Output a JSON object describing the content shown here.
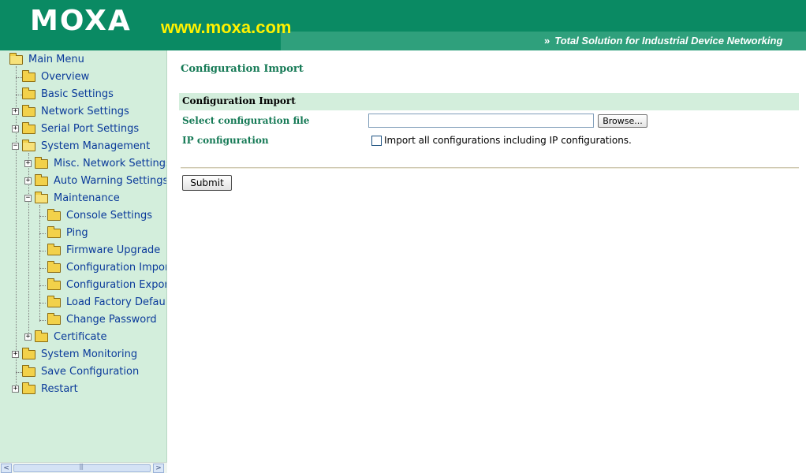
{
  "header": {
    "logo": "MOXA",
    "url": "www.moxa.com",
    "tagline": "Total Solution for Industrial Device Networking",
    "tagline_prefix": "»"
  },
  "sidebar": {
    "items": [
      {
        "label": "Main Menu",
        "expander": "",
        "icon": "open-folder-icon"
      },
      {
        "label": "Overview",
        "expander": "",
        "icon": "folder-icon"
      },
      {
        "label": "Basic Settings",
        "expander": "",
        "icon": "folder-icon"
      },
      {
        "label": "Network Settings",
        "expander": "+",
        "icon": "folder-icon"
      },
      {
        "label": "Serial Port Settings",
        "expander": "+",
        "icon": "folder-icon"
      },
      {
        "label": "System Management",
        "expander": "−",
        "icon": "open-folder-icon"
      },
      {
        "label": "Misc. Network Settings",
        "expander": "+",
        "icon": "folder-icon"
      },
      {
        "label": "Auto Warning Settings",
        "expander": "+",
        "icon": "folder-icon"
      },
      {
        "label": "Maintenance",
        "expander": "−",
        "icon": "open-folder-icon"
      },
      {
        "label": "Console Settings",
        "expander": "",
        "icon": "folder-icon"
      },
      {
        "label": "Ping",
        "expander": "",
        "icon": "folder-icon"
      },
      {
        "label": "Firmware Upgrade",
        "expander": "",
        "icon": "folder-icon"
      },
      {
        "label": "Configuration Impor",
        "expander": "",
        "icon": "folder-icon"
      },
      {
        "label": "Configuration Export",
        "expander": "",
        "icon": "folder-icon"
      },
      {
        "label": "Load Factory Default",
        "expander": "",
        "icon": "folder-icon"
      },
      {
        "label": "Change Password",
        "expander": "",
        "icon": "folder-icon"
      },
      {
        "label": "Certificate",
        "expander": "+",
        "icon": "folder-icon"
      },
      {
        "label": "System Monitoring",
        "expander": "+",
        "icon": "folder-icon"
      },
      {
        "label": "Save Configuration",
        "expander": "",
        "icon": "folder-icon"
      },
      {
        "label": "Restart",
        "expander": "+",
        "icon": "folder-icon"
      }
    ],
    "scroll_left": "<",
    "scroll_right": ">"
  },
  "main": {
    "page_title": "Configuration Import",
    "section_title": "Configuration Import",
    "select_file_label": "Select configuration file",
    "file_value": "",
    "browse_label": "Browse...",
    "ip_config_label": "IP configuration",
    "ip_checkbox_checked": false,
    "ip_checkbox_label": "Import all configurations including IP configurations.",
    "submit_label": "Submit"
  },
  "colors": {
    "header_green": "#0a8a63",
    "url_yellow": "#fff200",
    "sidebar_bg": "#d3eedc",
    "label_green": "#167a56",
    "link_blue": "#0a3a9a"
  }
}
